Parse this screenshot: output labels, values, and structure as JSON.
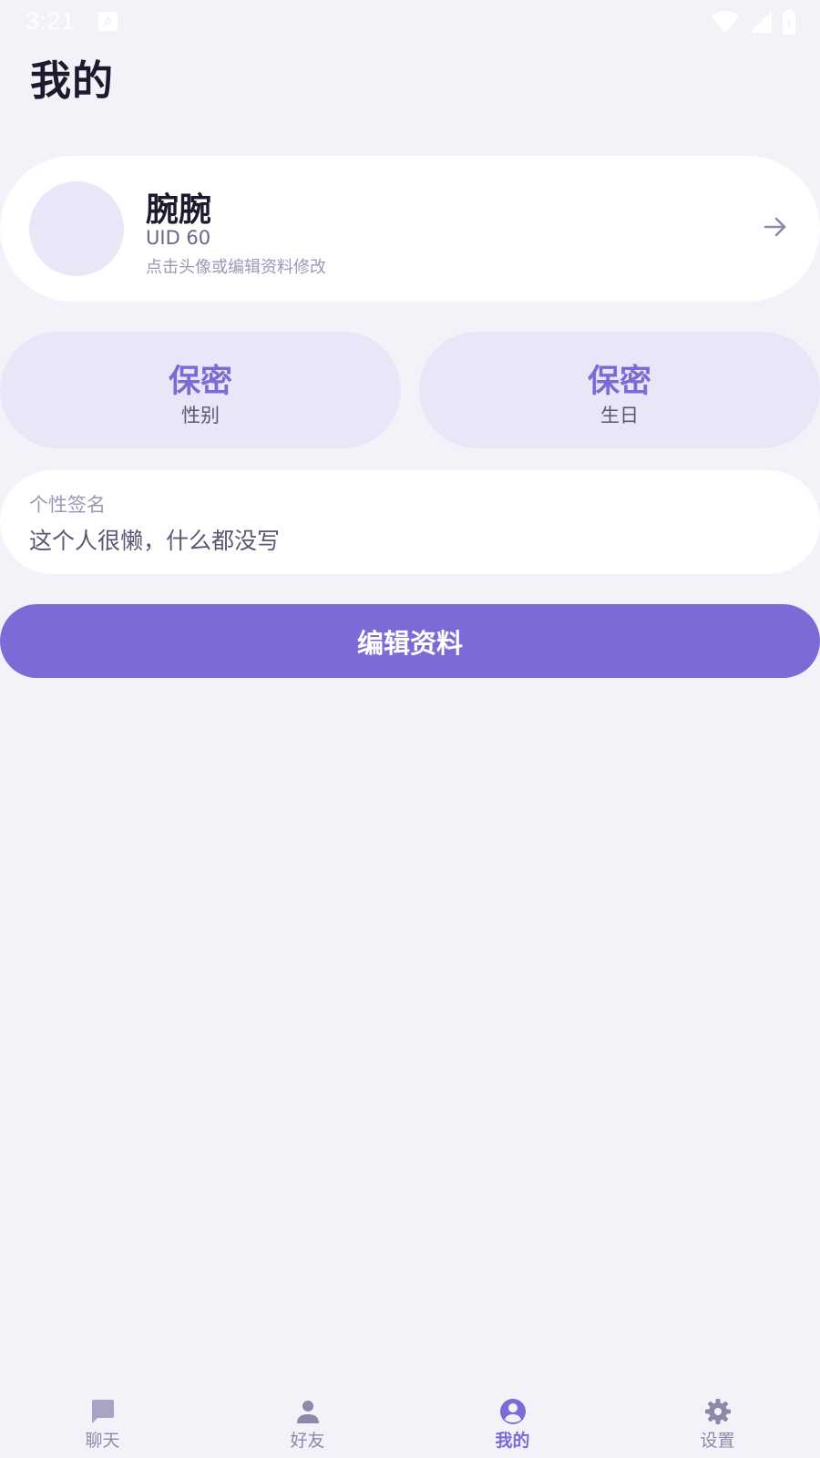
{
  "status_bar": {
    "time": "3:21",
    "notification_icon": "a-icon",
    "icons": [
      "wifi-icon",
      "signal-icon",
      "battery-icon"
    ]
  },
  "page": {
    "title": "我的"
  },
  "profile": {
    "name": "腕腕",
    "uid": "UID 60",
    "hint": "点击头像或编辑资料修改",
    "avatar_color": "#e9e6f8",
    "action_icon": "arrow-right-icon"
  },
  "stats": {
    "gender": {
      "value": "保密",
      "label": "性别"
    },
    "birthday": {
      "value": "保密",
      "label": "生日"
    }
  },
  "signature": {
    "label": "个性签名",
    "text": "这个人很懒，什么都没写"
  },
  "edit_button": {
    "label": "编辑资料"
  },
  "bottom_nav": {
    "items": [
      {
        "label": "聊天",
        "icon": "chat-icon",
        "active": false
      },
      {
        "label": "好友",
        "icon": "person-icon",
        "active": false
      },
      {
        "label": "我的",
        "icon": "account-circle-icon",
        "active": true
      },
      {
        "label": "设置",
        "icon": "gear-icon",
        "active": false
      }
    ]
  },
  "colors": {
    "background": "#f4f2f9",
    "accent": "#7b6bd6",
    "card": "#ffffff",
    "stat_card": "#e9e6f8",
    "text_primary": "#1c1a2e",
    "text_secondary": "#5b5872",
    "text_hint": "#9b98b5",
    "nav_inactive": "#8d8aa8"
  }
}
